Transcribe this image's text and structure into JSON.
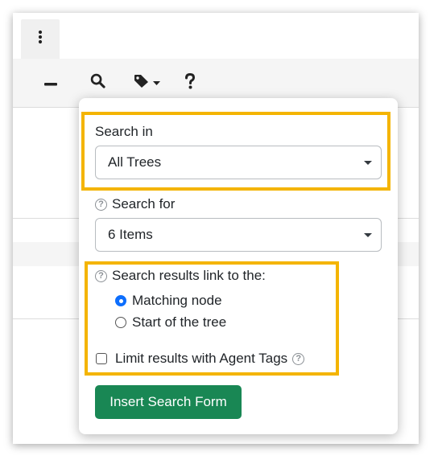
{
  "tabs": {
    "active_icon": "kebab-menu-icon"
  },
  "toolbar": {
    "buttons": [
      {
        "icon": "minus-icon"
      },
      {
        "icon": "search-icon"
      },
      {
        "icon": "tag-icon",
        "has_dropdown": true
      },
      {
        "icon": "help-icon"
      }
    ]
  },
  "search_popover": {
    "search_in": {
      "label": "Search in",
      "selected": "All Trees"
    },
    "search_for": {
      "label": "Search for",
      "selected": "6 Items",
      "help_icon": "question-circle-icon"
    },
    "results_link": {
      "label": "Search results link to the:",
      "options": [
        {
          "label": "Matching node",
          "checked": true
        },
        {
          "label": "Start of the tree",
          "checked": false
        }
      ]
    },
    "agent_tags": {
      "label": "Limit results with Agent Tags",
      "checked": false
    },
    "insert_button": "Insert Search Form"
  },
  "colors": {
    "highlight": "#f4b400",
    "primary_button": "#198754",
    "radio_checked": "#0d6efd"
  }
}
